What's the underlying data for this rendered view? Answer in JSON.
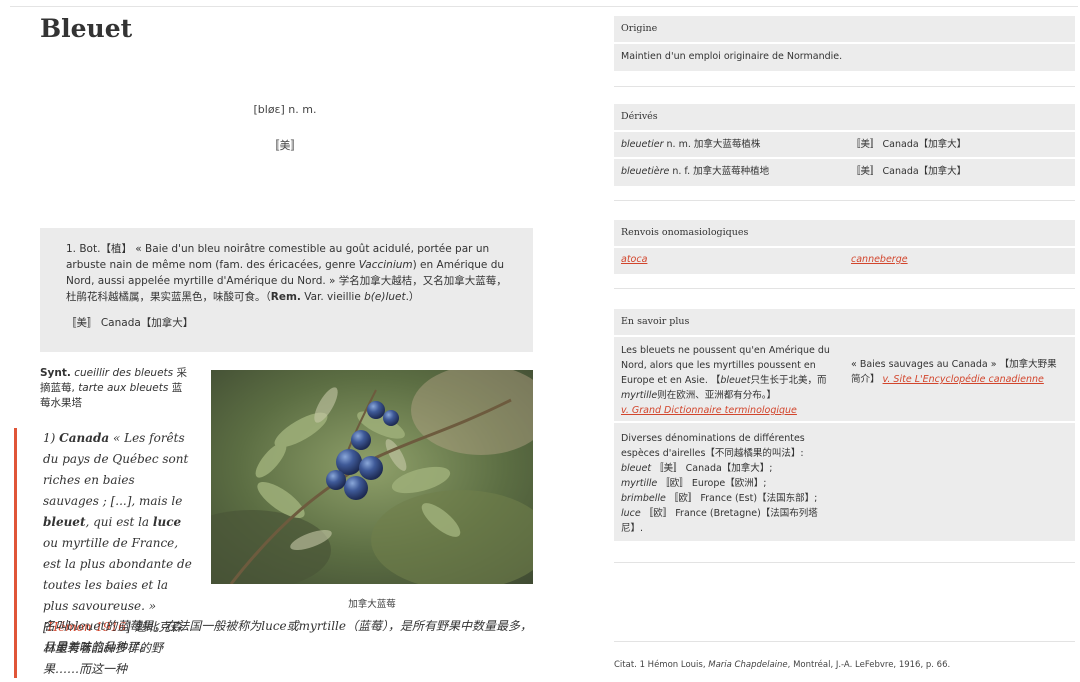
{
  "entry": {
    "headword": "Bleuet",
    "pronunciation": "[bløɛ] n. m.",
    "region": "〚美〛"
  },
  "definition": {
    "bot": "1. Bot.【植】",
    "open_quote": " « Baie d'un bleu noirâtre comestible au goût acidulé, portée par un arbuste nain de même nom (fam. des éricacées, genre ",
    "genus": "Vaccinium",
    "cont": ") en Amérique du Nord, aussi appelée myrtille d'Amérique du Nord. » 学名加拿大越桔，又名加拿大蓝莓，杜鹃花科越橘属，果实蓝黑色，味酸可食。（",
    "rem": "Rem.",
    "var": " Var. vieillie ",
    "variant": "b(e)luet",
    "end": ".）",
    "region": "〚美〛 Canada【加拿大】"
  },
  "synt": {
    "label": "Synt.",
    "p1": " cueillir des bleuets",
    "p1_zh": " 采摘蓝莓, ",
    "p2": "tarte aux bleuets",
    "p2_zh": " 蓝莓水果塔"
  },
  "photo": {
    "caption": "加拿大蓝莓"
  },
  "citation": {
    "num": "1) ",
    "region": "Canada",
    "t1": " « Les forêts du pays de Québec sont riches en baies sauvages ; [...], mais le ",
    "b1": "bleuet",
    "t2": ", qui est la ",
    "b2": "luce",
    "t3": " ou myrtille de France, est la plus abondante de toutes les baies et la plus savoureuse. » [",
    "source": "Hémon 1916",
    "t4": "] 魁北克森林里有着品种多样的野果……而这一种",
    "t5": "名叫bleuet的蓝莓果，在法国一般被称为luce或myrtille（蓝莓），是所有野果中数量最多，且最美味的品种了。"
  },
  "origine": {
    "heading": "Origine",
    "text": "Maintien d'un emploi originaire de Normandie."
  },
  "derives": {
    "heading": "Dérivés",
    "rows": [
      {
        "word": "bleuetier",
        "def": " n. m. 加拿大蓝莓植株",
        "region": "〚美〛 Canada【加拿大】"
      },
      {
        "word": "bleuetière",
        "def": " n. f. 加拿大蓝莓种植地",
        "region": "〚美〛 Canada【加拿大】"
      }
    ]
  },
  "renvois": {
    "heading": "Renvois onomasiologiques",
    "links": [
      "atoca",
      "canneberge"
    ]
  },
  "savoir": {
    "heading": "En savoir plus",
    "p1": "Les bleuets ne poussent qu'en Amérique du Nord, alors que les myrtilles poussent en Europe et en Asie. 【",
    "p1_w1": "bleuet",
    "p1_zh": "只生长于北美，而",
    "p1_w2": "myrtille",
    "p1_zh2": "则在欧洲、亚洲都有分布。】",
    "p1_link": "v. Grand Dictionnaire terminologique",
    "right_text": "« Baies sauvages au Canada » 【加拿大野果简介】",
    "right_link": "v. Site L'Encyclopédie canadienne",
    "p2_intro": "Diverses dénominations de différentes espèces d'airelles【不同越橘果的叫法】:",
    "lines": [
      {
        "w": "bleuet",
        "rest": " 〚美〛 Canada【加拿大】;"
      },
      {
        "w": "myrtille",
        "rest": " 〚欧〛 Europe【欧洲】;"
      },
      {
        "w": "brimbelle",
        "rest": " 〚欧〛 France (Est)【法国东部】;"
      },
      {
        "w": "luce",
        "rest": " 〚欧〛 France (Bretagne)【法国布列塔尼】."
      }
    ]
  },
  "footnote": {
    "pre": "Citat. 1 Hémon Louis, ",
    "book": "Maria Chapdelaine",
    "post": ", Montréal, J.-A. LeFebvre, 1916, p. 66."
  },
  "colors": {
    "accent": "#d2452c",
    "panel": "#ececec",
    "bar": "#e05538"
  }
}
